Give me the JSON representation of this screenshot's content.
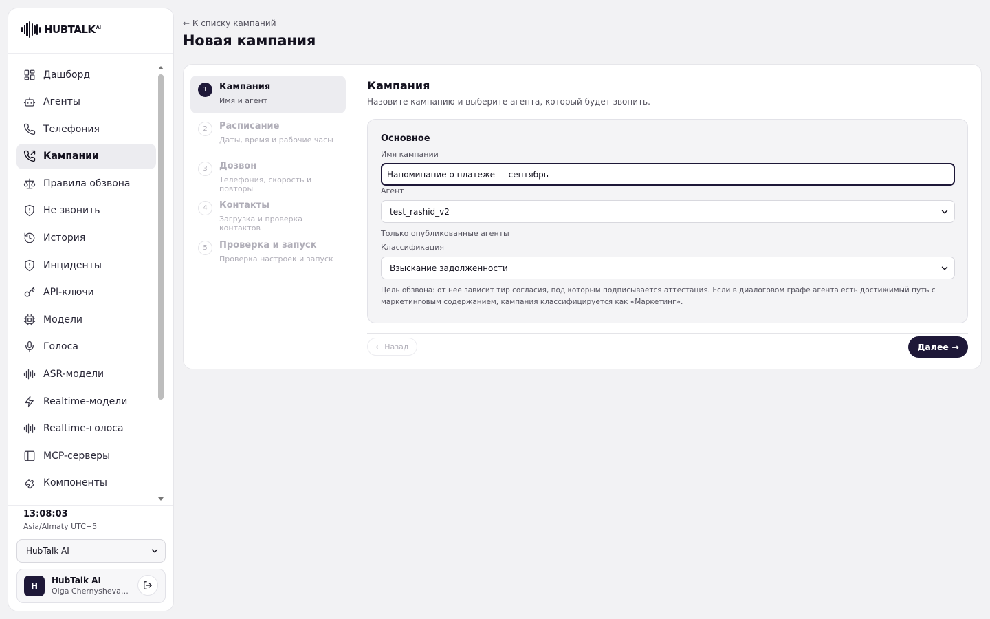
{
  "app": {
    "logo_text": "HUBTALK",
    "logo_sup": "AI"
  },
  "sidebar": {
    "items": [
      {
        "label": "Дашборд",
        "icon": "dashboard-icon"
      },
      {
        "label": "Агенты",
        "icon": "robot-icon"
      },
      {
        "label": "Телефония",
        "icon": "phone-icon"
      },
      {
        "label": "Кампании",
        "icon": "phone-outgoing-icon",
        "active": true
      },
      {
        "label": "Правила обзвона",
        "icon": "scale-icon"
      },
      {
        "label": "Не звонить",
        "icon": "shield-icon"
      },
      {
        "label": "История",
        "icon": "history-icon"
      },
      {
        "label": "Инциденты",
        "icon": "shield-alert-icon"
      },
      {
        "label": "API-ключи",
        "icon": "key-icon"
      },
      {
        "label": "Модели",
        "icon": "chip-icon"
      },
      {
        "label": "Голоса",
        "icon": "mic-icon"
      },
      {
        "label": "ASR-модели",
        "icon": "audio-lines-icon"
      },
      {
        "label": "Realtime-модели",
        "icon": "zap-icon"
      },
      {
        "label": "Realtime-голоса",
        "icon": "audio-lines-icon"
      },
      {
        "label": "MCP-серверы",
        "icon": "panel-icon"
      },
      {
        "label": "Компоненты",
        "icon": "puzzle-icon"
      }
    ],
    "clock": "13:08:03",
    "timezone": "Asia/Almaty UTC+5",
    "org_select": "HubTalk AI",
    "user": {
      "avatar_letter": "H",
      "name": "HubTalk AI",
      "email": "Olga Chernysheva · …"
    }
  },
  "header": {
    "back_link": "← К списку кампаний",
    "title": "Новая кампания"
  },
  "steps": [
    {
      "num": "1",
      "title": "Кампания",
      "sub": "Имя и агент",
      "active": true
    },
    {
      "num": "2",
      "title": "Расписание",
      "sub": "Даты, время и рабочие часы"
    },
    {
      "num": "3",
      "title": "Дозвон",
      "sub": "Телефония, скорость и повторы"
    },
    {
      "num": "4",
      "title": "Контакты",
      "sub": "Загрузка и проверка контактов"
    },
    {
      "num": "5",
      "title": "Проверка и запуск",
      "sub": "Проверка настроек и запуск"
    }
  ],
  "form": {
    "title": "Кампания",
    "subtitle": "Назовите кампанию и выберите агента, который будет звонить.",
    "section_title": "Основное",
    "name_label": "Имя кампании",
    "name_value": "Напоминание о платеже — сентябрь",
    "agent_label": "Агент",
    "agent_value": "test_rashid_v2",
    "agent_hint": "Только опубликованные агенты",
    "class_label": "Классификация",
    "class_value": "Взыскание задолженности",
    "class_hint": "Цель обзвона: от неё зависит тир согласия, под которым подписывается аттестация. Если в диалоговом графе агента есть достижимый путь с маркетинговым содержанием, кампания классифицируется как «Маркетинг».",
    "back_button": "← Назад",
    "next_button": "Далее →"
  },
  "colors": {
    "accent": "#1e1838",
    "background": "#f2f2f4",
    "muted": "#b0aeb8"
  }
}
